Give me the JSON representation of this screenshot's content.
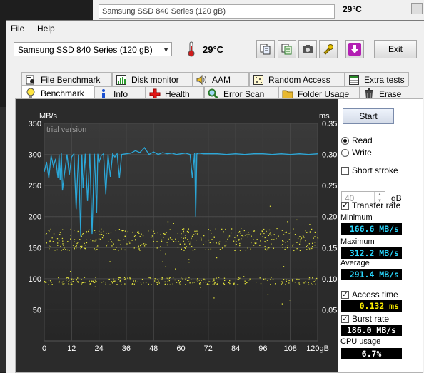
{
  "background_window": {
    "drive": "Samsung SSD 840 Series (120 gB)",
    "temperature": "29°C"
  },
  "menu": {
    "file": "File",
    "help": "Help"
  },
  "toolbar": {
    "drive_selected": "Samsung SSD 840 Series (120 gB)",
    "temperature": "29°C",
    "exit_label": "Exit",
    "icons": [
      "copy-info-icon",
      "copy-text-icon",
      "screenshot-camera-icon",
      "options-icon",
      "download-icon"
    ]
  },
  "tabs_top": [
    {
      "label": "File Benchmark",
      "icon": "file-benchmark-icon"
    },
    {
      "label": "Disk monitor",
      "icon": "disk-monitor-icon"
    },
    {
      "label": "AAM",
      "icon": "speaker-icon"
    },
    {
      "label": "Random Access",
      "icon": "random-access-icon"
    },
    {
      "label": "Extra tests",
      "icon": "extra-tests-icon"
    }
  ],
  "tabs_bottom": [
    {
      "label": "Benchmark",
      "icon": "benchmark-bulb-icon",
      "active": true
    },
    {
      "label": "Info",
      "icon": "info-icon"
    },
    {
      "label": "Health",
      "icon": "health-cross-icon"
    },
    {
      "label": "Error Scan",
      "icon": "error-scan-icon"
    },
    {
      "label": "Folder Usage",
      "icon": "folder-icon"
    },
    {
      "label": "Erase",
      "icon": "trash-icon"
    }
  ],
  "controls": {
    "start_label": "Start",
    "read_label": "Read",
    "write_label": "Write",
    "mode": "Read",
    "short_stroke_label": "Short stroke",
    "short_stroke_checked": false,
    "short_stroke_value": "40",
    "short_stroke_unit": "gB",
    "transfer_rate_label": "Transfer rate",
    "transfer_rate_checked": true,
    "access_time_label": "Access time",
    "access_time_checked": true,
    "burst_rate_label": "Burst rate",
    "burst_rate_checked": true
  },
  "stats": {
    "minimum_label": "Minimum",
    "minimum": "166.6 MB/s",
    "maximum_label": "Maximum",
    "maximum": "312.2 MB/s",
    "average_label": "Average",
    "average": "291.4 MB/s",
    "access_time": "0.132 ms",
    "burst_rate": "186.0 MB/s",
    "cpu_label": "CPU usage",
    "cpu": "6.7%"
  },
  "chart_data": {
    "type": "line",
    "watermark": "trial version",
    "left_axis": {
      "unit": "MB/s",
      "ylim": [
        0,
        350
      ],
      "ticks": [
        50,
        100,
        150,
        200,
        250,
        300,
        350
      ]
    },
    "right_axis": {
      "unit": "ms",
      "ylim": [
        0,
        0.35
      ],
      "ticks": [
        "0.05",
        "0.10",
        "0.15",
        "0.20",
        "0.25",
        "0.30",
        "0.35"
      ]
    },
    "x_axis": {
      "xlim": [
        0,
        120
      ],
      "ticks": [
        "0",
        "12",
        "24",
        "36",
        "48",
        "60",
        "72",
        "84",
        "96",
        "108",
        "120gB"
      ]
    },
    "grid": true,
    "colors": {
      "transfer": "#2ba7d8",
      "access": "#e6e63c",
      "plot_bg": "#2b2b2b"
    },
    "transfer_rate": {
      "x": [
        0,
        1,
        2,
        3,
        4,
        5,
        6,
        6.5,
        7,
        7.5,
        8,
        9,
        10,
        11,
        12,
        13,
        14,
        15,
        16,
        16.5,
        17,
        18,
        19,
        20,
        21,
        22,
        23,
        23.5,
        24,
        25,
        26,
        27,
        28,
        29,
        30,
        31,
        32,
        33,
        34,
        36,
        38,
        40,
        42,
        44,
        46,
        48,
        50,
        52,
        54,
        56,
        58,
        60,
        62,
        64,
        65,
        66,
        66.5,
        67,
        68,
        70,
        72,
        76,
        80,
        84,
        88,
        92,
        96,
        100,
        104,
        108,
        112,
        116,
        120
      ],
      "y": [
        272,
        288,
        262,
        298,
        281,
        293,
        262,
        300,
        259,
        302,
        242,
        272,
        300,
        267,
        296,
        301,
        212,
        300,
        168,
        300,
        246,
        301,
        225,
        301,
        172,
        301,
        206,
        301,
        287,
        298,
        301,
        236,
        300,
        264,
        301,
        296,
        301,
        262,
        300,
        301,
        302,
        306,
        303,
        311,
        300,
        304,
        300,
        303,
        301,
        302,
        300,
        301,
        302,
        300,
        262,
        303,
        200,
        301,
        302,
        301,
        301,
        301,
        300,
        301,
        300,
        301,
        301,
        300,
        301,
        300,
        301,
        300,
        301
      ]
    },
    "access_time": {
      "bands_ms": [
        0.097,
        0.155,
        0.172
      ],
      "x_range": [
        0,
        120
      ]
    }
  }
}
